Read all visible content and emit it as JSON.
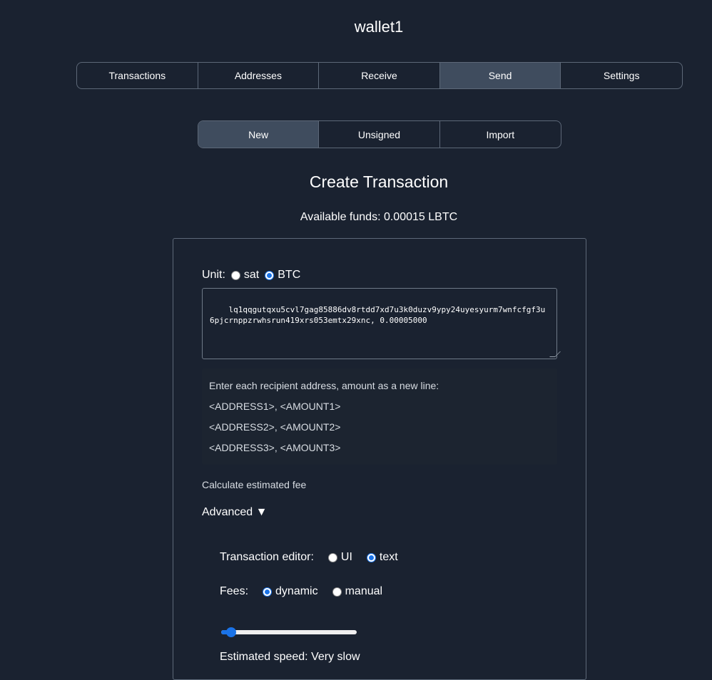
{
  "wallet_name": "wallet1",
  "main_tabs": [
    {
      "label": "Transactions",
      "active": false
    },
    {
      "label": "Addresses",
      "active": false
    },
    {
      "label": "Receive",
      "active": false
    },
    {
      "label": "Send",
      "active": true
    },
    {
      "label": "Settings",
      "active": false
    }
  ],
  "sub_tabs": [
    {
      "label": "New",
      "active": true
    },
    {
      "label": "Unsigned",
      "active": false
    },
    {
      "label": "Import",
      "active": false
    }
  ],
  "heading": "Create Transaction",
  "available_funds": "Available funds: 0.00015 LBTC",
  "unit": {
    "label": "Unit:",
    "options": [
      "sat",
      "BTC"
    ],
    "selected": "BTC"
  },
  "recipients_text": "lq1qqgutqxu5cvl7gag85886dv8rtdd7xd7u3k0duzv9ypy24uyesyurm7wnfcfgf3u6pjcrnppzrwhsrun419xrs053emtx29xnc, 0.00005000",
  "help": {
    "intro": "Enter each recipient address, amount as a new line:",
    "lines": [
      "<ADDRESS1>, <AMOUNT1>",
      "<ADDRESS2>, <AMOUNT2>",
      "<ADDRESS3>, <AMOUNT3>"
    ]
  },
  "calculate_fee_label": "Calculate estimated fee",
  "advanced_label": "Advanced ▼",
  "editor": {
    "label": "Transaction editor:",
    "options": [
      "UI",
      "text"
    ],
    "selected": "text"
  },
  "fees": {
    "label": "Fees:",
    "options": [
      "dynamic",
      "manual"
    ],
    "selected": "dynamic"
  },
  "fee_slider_fraction": 0.04,
  "estimated_speed": "Estimated speed: Very slow",
  "colors": {
    "background": "#1a2230",
    "active_tab": "#3f4c5e",
    "accent": "#1a73e8"
  }
}
